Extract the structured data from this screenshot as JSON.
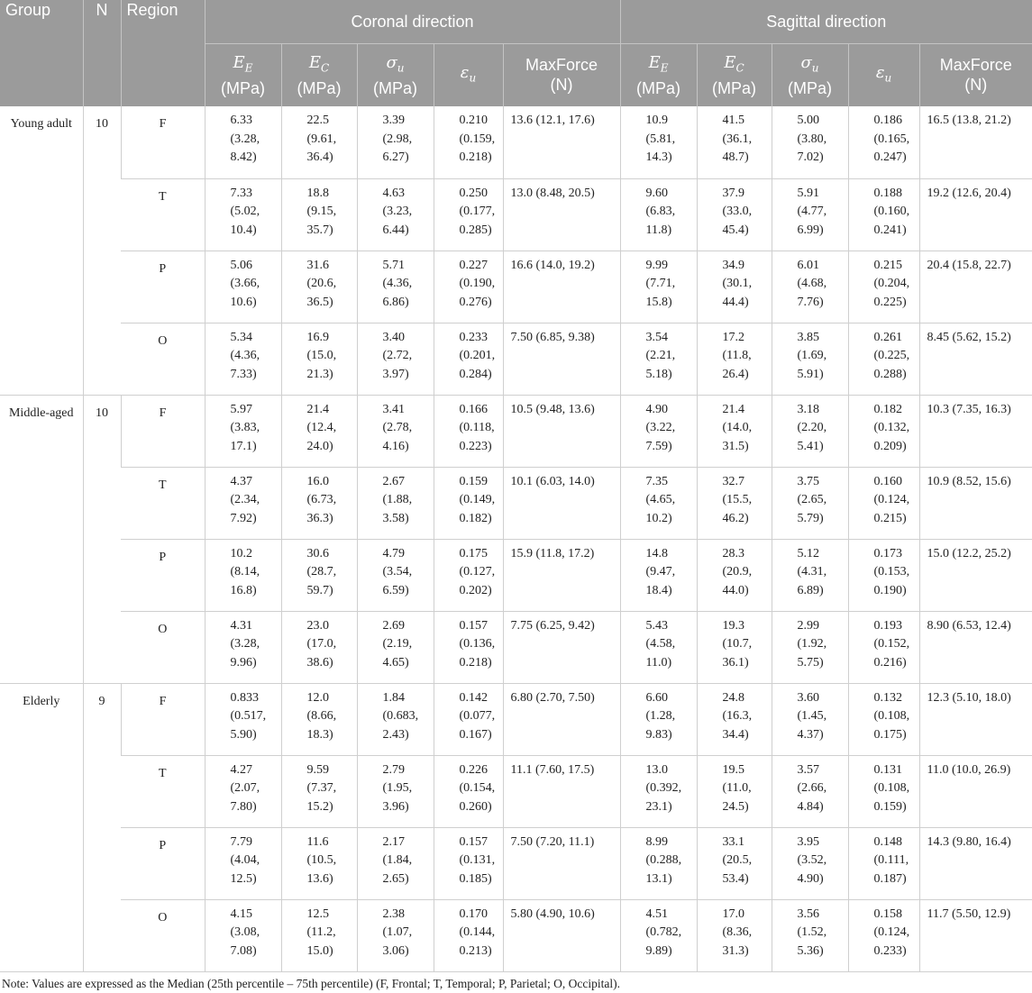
{
  "header": {
    "group": "Group",
    "n": "N",
    "region": "Region",
    "coronal": "Coronal direction",
    "sagittal": "Sagittal direction",
    "metrics": [
      {
        "symbol": "E",
        "sub": "E",
        "unit": "(MPa)"
      },
      {
        "symbol": "E",
        "sub": "C",
        "unit": "(MPa)"
      },
      {
        "symbol": "σ",
        "sub": "u",
        "unit": "(MPa)"
      },
      {
        "symbol": "ε",
        "sub": "u",
        "unit": ""
      },
      {
        "name": "MaxForce",
        "unit": "(N)"
      }
    ]
  },
  "groups": [
    {
      "name": "Young adult",
      "n": "10",
      "rows": [
        {
          "region": "F",
          "coronal": [
            [
              "6.33",
              "(3.28,",
              "8.42)"
            ],
            [
              "22.5",
              "(9.61,",
              "36.4)"
            ],
            [
              "3.39",
              "(2.98,",
              "6.27)"
            ],
            [
              "0.210",
              "(0.159,",
              "0.218)"
            ],
            "13.6 (12.1, 17.6)"
          ],
          "sagittal": [
            [
              "10.9",
              "(5.81,",
              "14.3)"
            ],
            [
              "41.5",
              "(36.1,",
              "48.7)"
            ],
            [
              "5.00",
              "(3.80,",
              "7.02)"
            ],
            [
              "0.186",
              "(0.165,",
              "0.247)"
            ],
            "16.5 (13.8, 21.2)"
          ]
        },
        {
          "region": "T",
          "coronal": [
            [
              "7.33",
              "(5.02,",
              "10.4)"
            ],
            [
              "18.8",
              "(9.15,",
              "35.7)"
            ],
            [
              "4.63",
              "(3.23,",
              "6.44)"
            ],
            [
              "0.250",
              "(0.177,",
              "0.285)"
            ],
            "13.0 (8.48, 20.5)"
          ],
          "sagittal": [
            [
              "9.60",
              "(6.83,",
              "11.8)"
            ],
            [
              "37.9",
              "(33.0,",
              "45.4)"
            ],
            [
              "5.91",
              "(4.77,",
              "6.99)"
            ],
            [
              "0.188",
              "(0.160,",
              "0.241)"
            ],
            "19.2 (12.6, 20.4)"
          ]
        },
        {
          "region": "P",
          "coronal": [
            [
              "5.06",
              "(3.66,",
              "10.6)"
            ],
            [
              "31.6",
              "(20.6,",
              "36.5)"
            ],
            [
              "5.71",
              "(4.36,",
              "6.86)"
            ],
            [
              "0.227",
              "(0.190,",
              "0.276)"
            ],
            "16.6 (14.0, 19.2)"
          ],
          "sagittal": [
            [
              "9.99",
              "(7.71,",
              "15.8)"
            ],
            [
              "34.9",
              "(30.1,",
              "44.4)"
            ],
            [
              "6.01",
              "(4.68,",
              "7.76)"
            ],
            [
              "0.215",
              "(0.204,",
              "0.225)"
            ],
            "20.4 (15.8, 22.7)"
          ]
        },
        {
          "region": "O",
          "coronal": [
            [
              "5.34",
              "(4.36,",
              "7.33)"
            ],
            [
              "16.9",
              "(15.0,",
              "21.3)"
            ],
            [
              "3.40",
              "(2.72,",
              "3.97)"
            ],
            [
              "0.233",
              "(0.201,",
              "0.284)"
            ],
            "7.50 (6.85, 9.38)"
          ],
          "sagittal": [
            [
              "3.54",
              "(2.21,",
              "5.18)"
            ],
            [
              "17.2",
              "(11.8,",
              "26.4)"
            ],
            [
              "3.85",
              "(1.69,",
              "5.91)"
            ],
            [
              "0.261",
              "(0.225,",
              "0.288)"
            ],
            "8.45 (5.62, 15.2)"
          ]
        }
      ]
    },
    {
      "name": "Middle-aged",
      "n": "10",
      "rows": [
        {
          "region": "F",
          "coronal": [
            [
              "5.97",
              "(3.83,",
              "17.1)"
            ],
            [
              "21.4",
              "(12.4,",
              "24.0)"
            ],
            [
              "3.41",
              "(2.78,",
              "4.16)"
            ],
            [
              "0.166",
              "(0.118,",
              "0.223)"
            ],
            "10.5 (9.48, 13.6)"
          ],
          "sagittal": [
            [
              "4.90",
              "(3.22,",
              "7.59)"
            ],
            [
              "21.4",
              "(14.0,",
              "31.5)"
            ],
            [
              "3.18",
              "(2.20,",
              "5.41)"
            ],
            [
              "0.182",
              "(0.132,",
              "0.209)"
            ],
            "10.3 (7.35, 16.3)"
          ]
        },
        {
          "region": "T",
          "coronal": [
            [
              "4.37",
              "(2.34,",
              "7.92)"
            ],
            [
              "16.0",
              "(6.73,",
              "36.3)"
            ],
            [
              "2.67",
              "(1.88,",
              "3.58)"
            ],
            [
              "0.159",
              "(0.149,",
              "0.182)"
            ],
            "10.1 (6.03, 14.0)"
          ],
          "sagittal": [
            [
              "7.35",
              "(4.65,",
              "10.2)"
            ],
            [
              "32.7",
              "(15.5,",
              "46.2)"
            ],
            [
              "3.75",
              "(2.65,",
              "5.79)"
            ],
            [
              "0.160",
              "(0.124,",
              "0.215)"
            ],
            "10.9 (8.52, 15.6)"
          ]
        },
        {
          "region": "P",
          "coronal": [
            [
              "10.2",
              "(8.14,",
              "16.8)"
            ],
            [
              "30.6",
              "(28.7,",
              "59.7)"
            ],
            [
              "4.79",
              "(3.54,",
              "6.59)"
            ],
            [
              "0.175",
              "(0.127,",
              "0.202)"
            ],
            "15.9 (11.8, 17.2)"
          ],
          "sagittal": [
            [
              "14.8",
              "(9.47,",
              "18.4)"
            ],
            [
              "28.3",
              "(20.9,",
              "44.0)"
            ],
            [
              "5.12",
              "(4.31,",
              "6.89)"
            ],
            [
              "0.173",
              "(0.153,",
              "0.190)"
            ],
            "15.0 (12.2, 25.2)"
          ]
        },
        {
          "region": "O",
          "coronal": [
            [
              "4.31",
              "(3.28,",
              "9.96)"
            ],
            [
              "23.0",
              "(17.0,",
              "38.6)"
            ],
            [
              "2.69",
              "(2.19,",
              "4.65)"
            ],
            [
              "0.157",
              "(0.136,",
              "0.218)"
            ],
            "7.75 (6.25, 9.42)"
          ],
          "sagittal": [
            [
              "5.43",
              "(4.58,",
              "11.0)"
            ],
            [
              "19.3",
              "(10.7,",
              "36.1)"
            ],
            [
              "2.99",
              "(1.92,",
              "5.75)"
            ],
            [
              "0.193",
              "(0.152,",
              "0.216)"
            ],
            "8.90 (6.53, 12.4)"
          ]
        }
      ]
    },
    {
      "name": "Elderly",
      "n": "9",
      "rows": [
        {
          "region": "F",
          "coronal": [
            [
              "0.833",
              "(0.517,",
              "5.90)"
            ],
            [
              "12.0",
              "(8.66,",
              "18.3)"
            ],
            [
              "1.84",
              "(0.683,",
              "2.43)"
            ],
            [
              "0.142",
              "(0.077,",
              "0.167)"
            ],
            "6.80 (2.70, 7.50)"
          ],
          "sagittal": [
            [
              "6.60",
              "(1.28,",
              "9.83)"
            ],
            [
              "24.8",
              "(16.3,",
              "34.4)"
            ],
            [
              "3.60",
              "(1.45,",
              "4.37)"
            ],
            [
              "0.132",
              "(0.108,",
              "0.175)"
            ],
            "12.3 (5.10, 18.0)"
          ]
        },
        {
          "region": "T",
          "coronal": [
            [
              "4.27",
              "(2.07,",
              "7.80)"
            ],
            [
              "9.59",
              "(7.37,",
              "15.2)"
            ],
            [
              "2.79",
              "(1.95,",
              "3.96)"
            ],
            [
              "0.226",
              "(0.154,",
              "0.260)"
            ],
            "11.1 (7.60, 17.5)"
          ],
          "sagittal": [
            [
              "13.0",
              "(0.392,",
              "23.1)"
            ],
            [
              "19.5",
              "(11.0,",
              "24.5)"
            ],
            [
              "3.57",
              "(2.66,",
              "4.84)"
            ],
            [
              "0.131",
              "(0.108,",
              "0.159)"
            ],
            "11.0 (10.0, 26.9)"
          ]
        },
        {
          "region": "P",
          "coronal": [
            [
              "7.79",
              "(4.04,",
              "12.5)"
            ],
            [
              "11.6",
              "(10.5,",
              "13.6)"
            ],
            [
              "2.17",
              "(1.84,",
              "2.65)"
            ],
            [
              "0.157",
              "(0.131,",
              "0.185)"
            ],
            "7.50 (7.20, 11.1)"
          ],
          "sagittal": [
            [
              "8.99",
              "(0.288,",
              "13.1)"
            ],
            [
              "33.1",
              "(20.5,",
              "53.4)"
            ],
            [
              "3.95",
              "(3.52,",
              "4.90)"
            ],
            [
              "0.148",
              "(0.111,",
              "0.187)"
            ],
            "14.3 (9.80, 16.4)"
          ]
        },
        {
          "region": "O",
          "coronal": [
            [
              "4.15",
              "(3.08,",
              "7.08)"
            ],
            [
              "12.5",
              "(11.2,",
              "15.0)"
            ],
            [
              "2.38",
              "(1.07,",
              "3.06)"
            ],
            [
              "0.170",
              "(0.144,",
              "0.213)"
            ],
            "5.80 (4.90, 10.6)"
          ],
          "sagittal": [
            [
              "4.51",
              "(0.782,",
              "9.89)"
            ],
            [
              "17.0",
              "(8.36,",
              "31.3)"
            ],
            [
              "3.56",
              "(1.52,",
              "5.36)"
            ],
            [
              "0.158",
              "(0.124,",
              "0.233)"
            ],
            "11.7 (5.50, 12.9)"
          ]
        }
      ]
    }
  ],
  "note": "Note: Values are expressed as the Median (25th percentile – 75th percentile) (F, Frontal; T, Temporal; P, Parietal; O, Occipital)."
}
